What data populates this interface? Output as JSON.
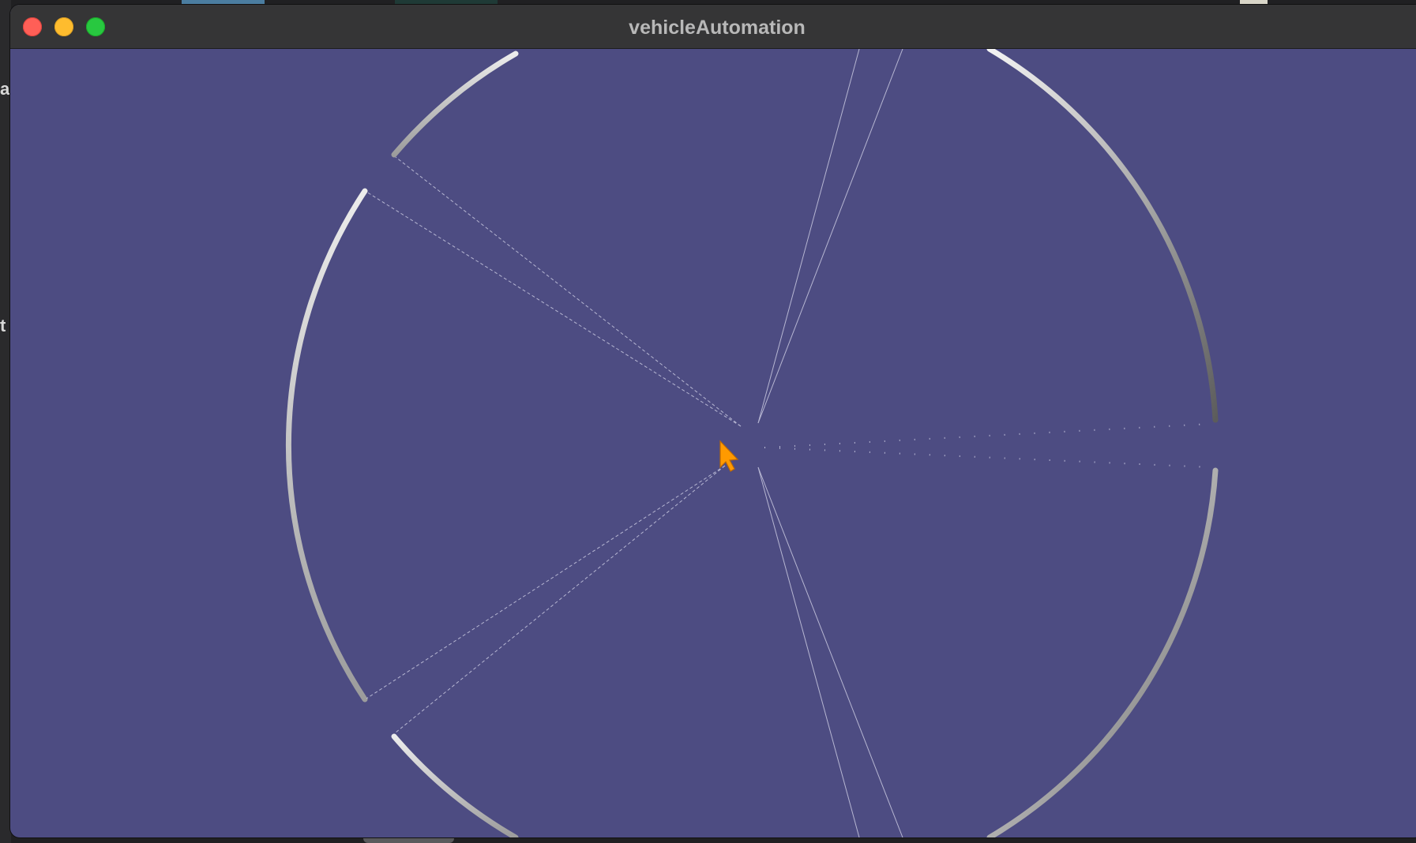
{
  "window": {
    "title": "vehicleAutomation",
    "background_color": "#4d4c82",
    "controls": [
      "close-button",
      "minimize-button",
      "zoom-button"
    ]
  },
  "scene": {
    "track_ring_colors": [
      "#f2f2f2",
      "#9a9a9a",
      "#5f5f5f"
    ],
    "sensor_ray_color": "#c9c9e0",
    "cursor_color": "#ff9a00",
    "cursor_icon": "arrow-cursor-icon"
  },
  "desktop": {
    "left_glyphs": [
      "a",
      "t"
    ]
  }
}
